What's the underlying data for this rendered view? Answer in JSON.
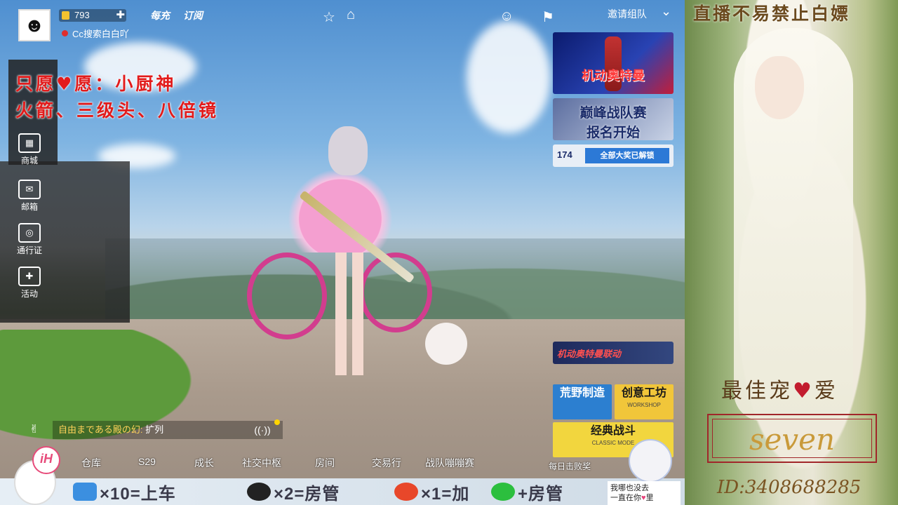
{
  "hud": {
    "currency": "793",
    "badge_1": "每充",
    "badge_2": "订阅",
    "status_text": "Cc搜索白白吖",
    "invite_label": "邀请组队"
  },
  "overlay": {
    "wish_line1": "只愿♥愿：小厨神",
    "wish_line2": "火箭、三级头、八倍镜"
  },
  "left_menu": [
    {
      "icon": "shop-icon",
      "glyph": "▦",
      "label": "商城"
    },
    {
      "icon": "mail-icon",
      "glyph": "✉",
      "label": "邮箱"
    },
    {
      "icon": "pass-icon",
      "glyph": "◎",
      "label": "通行证"
    },
    {
      "icon": "gift-icon",
      "glyph": "✚",
      "label": "活动"
    }
  ],
  "banners": {
    "b1_title": "机动奥特曼",
    "b2_line1": "巅峰战队赛",
    "b2_line2": "报名开始",
    "b3_count": "174",
    "b3_text": "全部大奖已解锁",
    "b4_text": "机动奥特曼联动"
  },
  "modes": [
    {
      "label": "荒野制造",
      "sub": "",
      "bg": "#2c7fd0"
    },
    {
      "label": "创意工坊",
      "sub": "WORKSHOP",
      "bg": "#f1c63a"
    },
    {
      "label": "经典战斗",
      "sub": "CLASSIC MODE",
      "bg": "#f2d63e"
    }
  ],
  "chat": {
    "speaker": "自由まである殿の幻:",
    "message": "扩列",
    "voice_badge": "1"
  },
  "bottom_nav": [
    "仓库",
    "S29",
    "成长",
    "社交中枢",
    "房间",
    "交易行",
    "战队嘣嘣赛"
  ],
  "daily_text": "每日击败奖",
  "strip": {
    "item1": "×10=上车",
    "item2": "×2=房管",
    "item3": "×1=加",
    "item4": "+房管",
    "mascot_text": "iH",
    "note_line1": "我哪也没去",
    "note_line2": "一直在你",
    "note_heart": "♥",
    "note_end": "里"
  },
  "side": {
    "title": "直播不易禁止白嫖",
    "best_pet_1": "最佳宠",
    "best_pet_heart": "♥",
    "best_pet_2": "爱",
    "name": "seven",
    "id": "ID:3408688285"
  },
  "colors": {
    "wish_red": "#e21b1b",
    "side_brown": "#6b4a1e",
    "name_gold": "#c99a3a",
    "frame_red": "#a1262a"
  }
}
